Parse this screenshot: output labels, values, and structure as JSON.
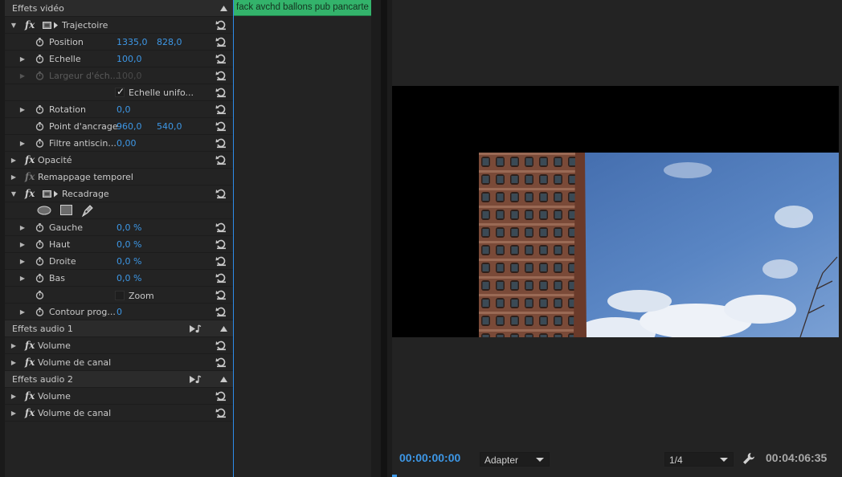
{
  "effects_panel": {
    "video_section_title": "Effets vidéo",
    "rows": {
      "trajectoire": "Trajectoire",
      "position": {
        "label": "Position",
        "x": "1335,0",
        "y": "828,0"
      },
      "echelle": {
        "label": "Echelle",
        "value": "100,0"
      },
      "largeur": {
        "label": "Largeur d'éch...",
        "value": "100,0"
      },
      "echelle_uniforme": "Echelle unifo...",
      "rotation": {
        "label": "Rotation",
        "value": "0,0"
      },
      "point_ancrage": {
        "label": "Point d'ancrage",
        "x": "960,0",
        "y": "540,0"
      },
      "filtre": {
        "label": "Filtre antiscin...",
        "value": "0,00"
      },
      "opacite": "Opacité",
      "remappage": "Remappage temporel",
      "recadrage": "Recadrage",
      "gauche": {
        "label": "Gauche",
        "value": "0,0 %"
      },
      "haut": {
        "label": "Haut",
        "value": "0,0 %"
      },
      "droite": {
        "label": "Droite",
        "value": "0,0 %"
      },
      "bas": {
        "label": "Bas",
        "value": "0,0 %"
      },
      "zoom": "Zoom",
      "contour": {
        "label": "Contour prog...",
        "value": "0"
      }
    },
    "audio1_title": "Effets audio 1",
    "audio1_volume": "Volume",
    "audio1_canal": "Volume de canal",
    "audio2_title": "Effets audio 2",
    "audio2_volume": "Volume",
    "audio2_canal": "Volume de canal",
    "fx_symbol": "fx"
  },
  "timeline": {
    "clip_name": "fack avchd ballons pub pancarte"
  },
  "monitor": {
    "current_timecode": "00:00:00:00",
    "fit_dropdown": "Adapter",
    "resolution_dropdown": "1/4",
    "duration_timecode": "00:04:06:35"
  },
  "colors": {
    "accent_blue": "#3d97e6",
    "clip_green": "#33b36b",
    "panel_bg": "#232323"
  },
  "icons": [
    "expand-arrow-icon",
    "fx-icon",
    "motion-icon",
    "stopwatch-icon",
    "reset-icon",
    "ellipse-mask-icon",
    "rectangle-mask-icon",
    "pen-mask-icon",
    "audio-icon",
    "collapse-arrow-icon",
    "wrench-icon",
    "dropdown-arrow-icon"
  ]
}
